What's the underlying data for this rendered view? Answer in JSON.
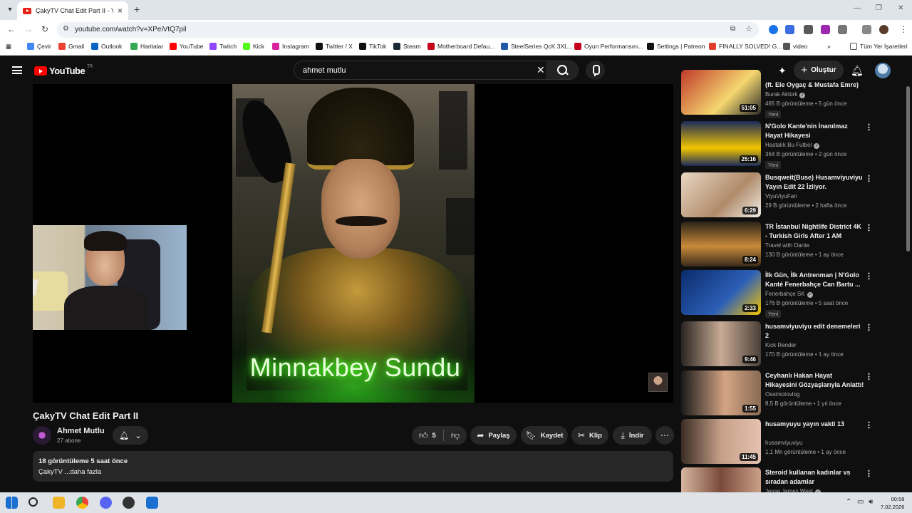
{
  "browser": {
    "tab_title": "ÇakyTV Chat Edit Part II - YouTube",
    "url": "youtube.com/watch?v=XPeiVtQ7pil",
    "bookmarks": [
      {
        "label": "Çevir",
        "color": "#4285f4"
      },
      {
        "label": "Gmail",
        "color": "#ea4335"
      },
      {
        "label": "Outlook",
        "color": "#0a64c2"
      },
      {
        "label": "Haritalar",
        "color": "#34a853"
      },
      {
        "label": "YouTube",
        "color": "#ff0000"
      },
      {
        "label": "Twitch",
        "color": "#9146ff"
      },
      {
        "label": "Kick",
        "color": "#53fc18"
      },
      {
        "label": "Instagram",
        "color": "#d6249f"
      },
      {
        "label": "Twitter / X",
        "color": "#111111"
      },
      {
        "label": "TikTok",
        "color": "#111111"
      },
      {
        "label": "Steam",
        "color": "#1b2838"
      },
      {
        "label": "Motherboard Defau...",
        "color": "#c4001a"
      },
      {
        "label": "SteelSeries QcK 3XL...",
        "color": "#1e5aa8"
      },
      {
        "label": "Oyun Performansını...",
        "color": "#c4001a"
      },
      {
        "label": "Settings | Patreon",
        "color": "#111111"
      },
      {
        "label": "FINALLY SOLVED! G...",
        "color": "#e0402a"
      },
      {
        "label": "video",
        "color": "#555555"
      }
    ],
    "all_bookmarks": "Tüm Yer İşaretleri"
  },
  "header": {
    "logo_text": "YouTube",
    "logo_region": "TR",
    "search_value": "ahmet mutlu",
    "create_label": "Oluştur"
  },
  "video": {
    "overlay_caption": "Minnakbey Sundu",
    "title": "ÇakyTV Chat Edit Part II",
    "channel": "Ahmet Mutlu",
    "subscribers": "27 abone",
    "likes": "5",
    "share_label": "Paylaş",
    "save_label": "Kaydet",
    "clip_label": "Klip",
    "download_label": "İndir",
    "views_time": "18 görüntüleme  5 saat önce",
    "desc_preview": "ÇakyTV ...daha fazla"
  },
  "recommendations": [
    {
      "title": "(ft. Ele Oygaç & Mustafa Emre)",
      "channel": "Burak Aktürk",
      "verified": true,
      "meta": "465 B görüntüleme • 5 gün önce",
      "badge": "Yeni",
      "duration": "51:05",
      "bg": "linear-gradient(135deg,#c0392b,#f5d76e 60%,#2c2c2c)"
    },
    {
      "title": "N'Golo Kante'nin İnanılmaz Hayat Hikayesi",
      "channel": "Hastalık Bu Futbol",
      "verified": true,
      "meta": "364 B görüntüleme • 2 gün önce",
      "badge": "Yeni",
      "duration": "25:16",
      "bg": "linear-gradient(180deg,#1b2a5a,#f2c500 60%,#1b2a5a)"
    },
    {
      "title": "Busqweit(Buse) Husamviyuviyu Yayın Edit 22 İzliyor.",
      "channel": "ViyuViyuFan",
      "verified": false,
      "meta": "29 B görüntüleme • 2 hafta önce",
      "badge": "",
      "duration": "6:29",
      "bg": "linear-gradient(135deg,#e8d6c3,#b08b6a 60%,#f3eee8)"
    },
    {
      "title": "TR İstanbul Nightlife District 4K - Turkish Girls After 1 AM",
      "channel": "Travel with Dante",
      "verified": false,
      "meta": "130 B görüntüleme • 1 ay önce",
      "badge": "",
      "duration": "8:24",
      "bg": "linear-gradient(180deg,#2b2418,#c98a3a 55%,#3a2a1a)"
    },
    {
      "title": "İlk Gün, İlk Antrenman | N'Golo Kanté Fenerbahçe Can Bartu ...",
      "channel": "Fenerbahçe SK",
      "verified": true,
      "meta": "176 B görüntüleme • 5 saat önce",
      "badge": "Yeni",
      "duration": "2:33",
      "bg": "linear-gradient(135deg,#0b2b6b,#2c5fb8 60%,#f5c400)"
    },
    {
      "title": "husamviyuviyu edit denemeleri 2",
      "channel": "Kick Render",
      "verified": false,
      "meta": "170 B görüntüleme • 1 ay önce",
      "badge": "",
      "duration": "9:46",
      "bg": "linear-gradient(90deg,#2a2522,#c9ab95 50%,#4a4038)"
    },
    {
      "title": "Ceyhanlı Hakan Hayat Hikayesini Gözyaşlarıyla Anlattı!",
      "channel": "Ossimotovlog",
      "verified": false,
      "meta": "8,5 B görüntüleme • 1 yıl önce",
      "badge": "",
      "duration": "1:55",
      "bg": "linear-gradient(90deg,#1a1a1a,#d4a584 55%,#8a6b55)"
    },
    {
      "title": "husamyuyu yayın vakti 13",
      "channel": "husamviyuviyu",
      "verified": false,
      "meta": "1,1 Mn görüntüleme • 1 ay önce",
      "badge": "",
      "duration": "11:45",
      "bg": "linear-gradient(90deg,#3a2c24,#c6a088 50%,#e4c2b0)"
    },
    {
      "title": "Steroid kullanan kadınlar vs sıradan adamlar",
      "channel": "Jesse James West",
      "verified": true,
      "meta": "",
      "badge": "",
      "duration": "",
      "bg": "linear-gradient(90deg,#d6b7a0,#7a4a3a 50%,#caa088)"
    }
  ],
  "taskbar": {
    "time": "00:58",
    "date": "7.02.2026"
  }
}
